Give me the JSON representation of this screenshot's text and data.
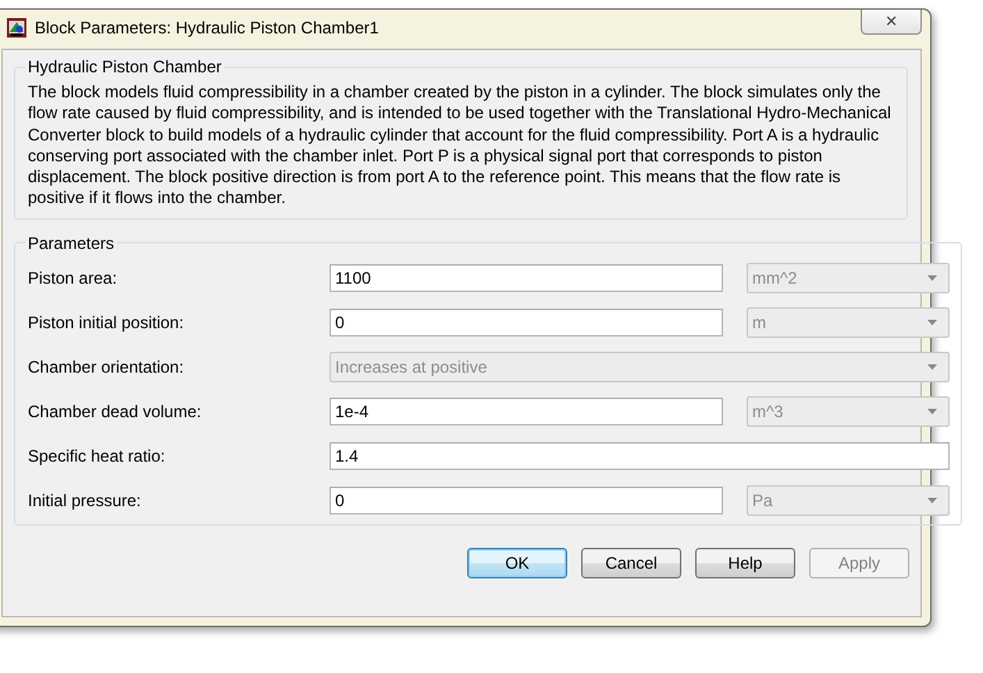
{
  "window": {
    "title": "Block Parameters: Hydraulic Piston Chamber1",
    "close": "✕"
  },
  "description": {
    "title": "Hydraulic Piston Chamber",
    "text": "The block models fluid compressibility in a chamber created by the piston in a cylinder. The block simulates only the flow rate caused by fluid compressibility, and is intended to be used together with the Translational Hydro-Mechanical Converter block to build models of a hydraulic cylinder that account for the fluid compressibility. Port A is a hydraulic conserving port associated with the chamber inlet. Port P is a physical signal port that corresponds to piston displacement. The block positive direction is from port A to the reference point. This means that the flow rate is positive if it flows into the chamber."
  },
  "parameters": {
    "title": "Parameters",
    "rows": [
      {
        "kind": "text_unit",
        "label": "Piston area:",
        "value": "1100",
        "unit": "mm^2",
        "unit_disabled": true
      },
      {
        "kind": "text_unit",
        "label": "Piston initial position:",
        "value": "0",
        "unit": "m",
        "unit_disabled": true
      },
      {
        "kind": "dropdown",
        "label": "Chamber orientation:",
        "value": "Increases at positive",
        "disabled": true
      },
      {
        "kind": "text_unit",
        "label": "Chamber dead volume:",
        "value": "1e-4",
        "unit": "m^3",
        "unit_disabled": true
      },
      {
        "kind": "text",
        "label": "Specific heat ratio:",
        "value": "1.4"
      },
      {
        "kind": "text_unit",
        "label": "Initial pressure:",
        "value": "0",
        "unit": "Pa",
        "unit_disabled": true
      }
    ]
  },
  "buttons": [
    {
      "label": "OK",
      "default": true,
      "disabled": false
    },
    {
      "label": "Cancel",
      "default": false,
      "disabled": false
    },
    {
      "label": "Help",
      "default": false,
      "disabled": false
    },
    {
      "label": "Apply",
      "default": false,
      "disabled": true
    }
  ]
}
